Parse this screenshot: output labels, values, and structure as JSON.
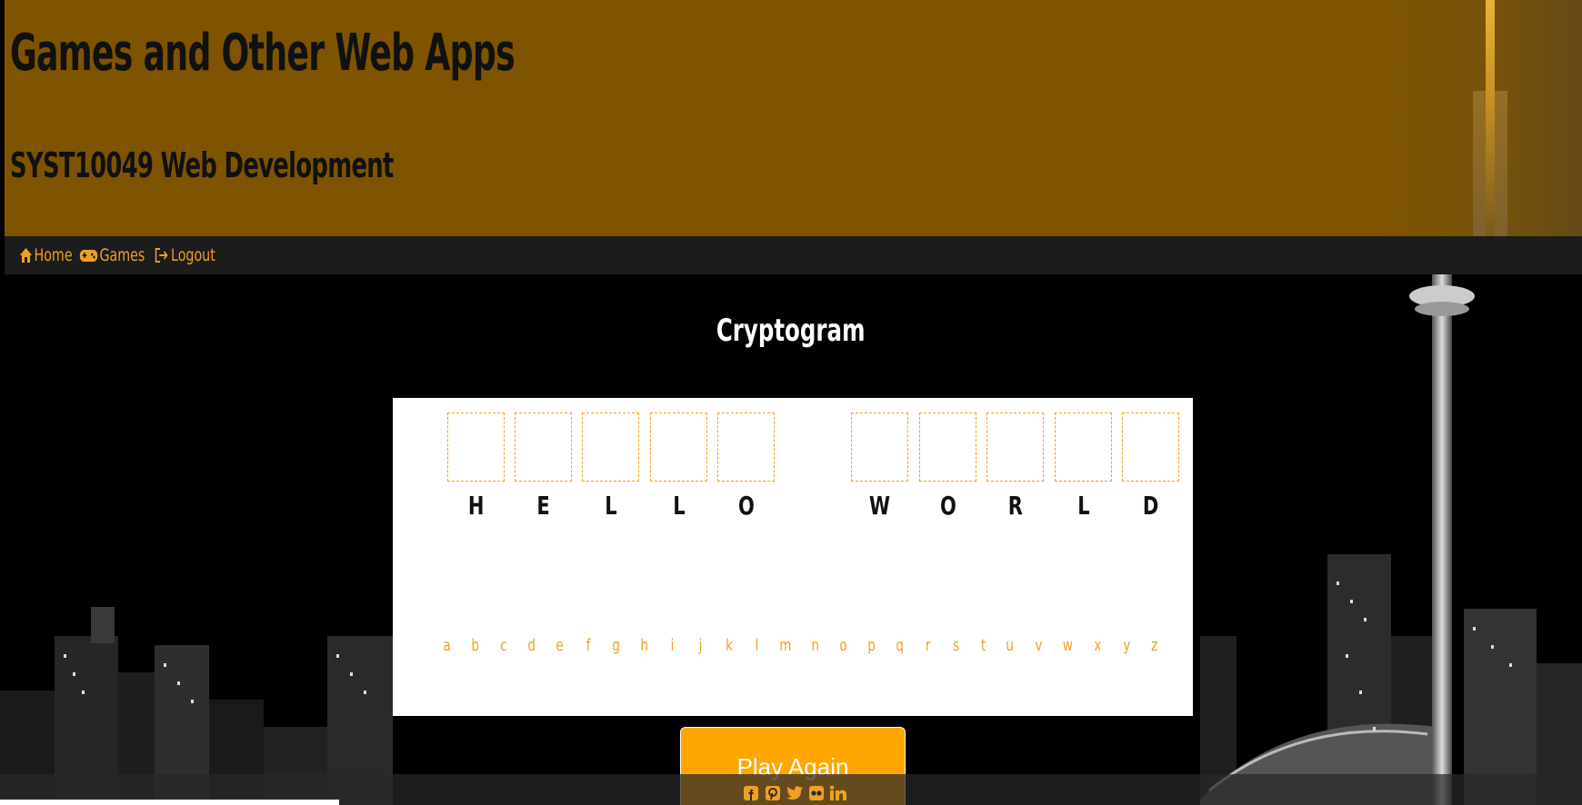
{
  "header": {
    "title": "Games and Other Web Apps",
    "subtitle": "SYST10049 Web Development"
  },
  "nav": {
    "home": "Home",
    "games": "Games",
    "logout": "Logout"
  },
  "game": {
    "title": "Cryptogram",
    "words": [
      [
        "H",
        "E",
        "L",
        "L",
        "O"
      ],
      [
        "W",
        "O",
        "R",
        "L",
        "D"
      ]
    ],
    "alphabet": [
      "a",
      "b",
      "c",
      "d",
      "e",
      "f",
      "g",
      "h",
      "i",
      "j",
      "k",
      "l",
      "m",
      "n",
      "o",
      "p",
      "q",
      "r",
      "s",
      "t",
      "u",
      "v",
      "w",
      "x",
      "y",
      "z"
    ],
    "play_again": "Play Again"
  },
  "footer": {
    "social": [
      "facebook-icon",
      "pinterest-icon",
      "twitter-icon",
      "flickr-icon",
      "linkedin-icon"
    ]
  },
  "colors": {
    "header_bg": "#7f5400",
    "accent": "#f0a020",
    "button": "#ffa600",
    "nav_bg": "#1c1c1c"
  }
}
